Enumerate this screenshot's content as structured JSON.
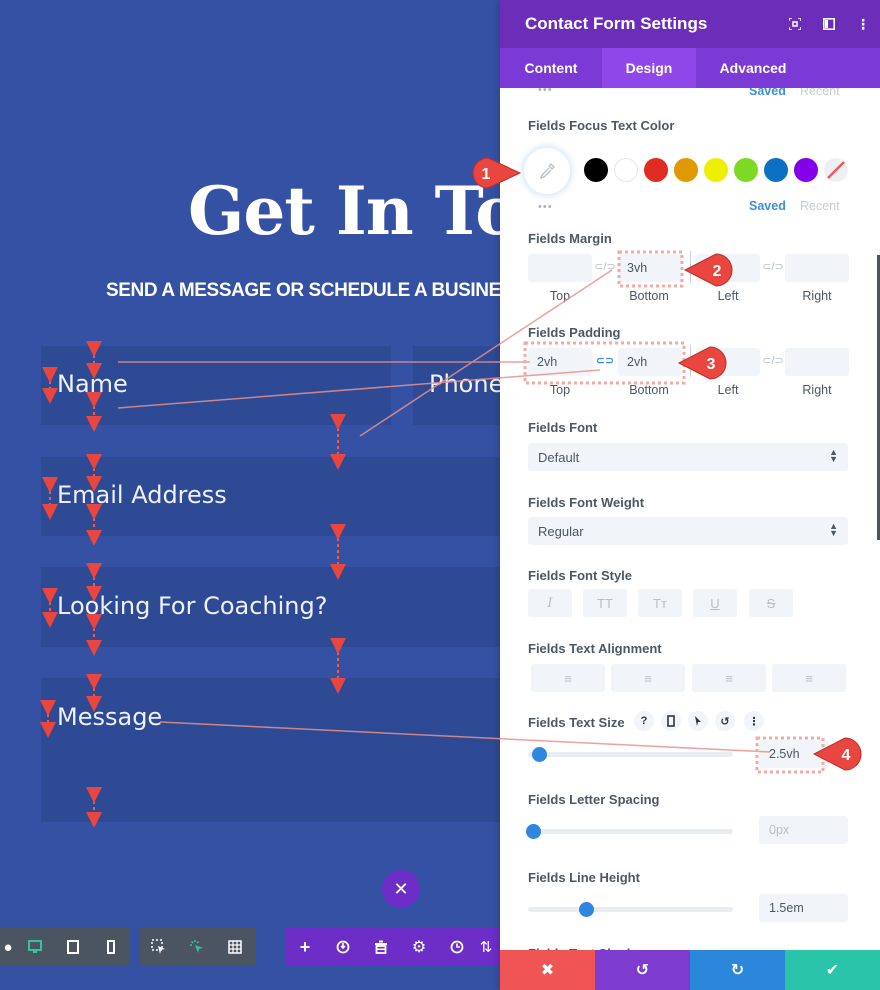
{
  "canvas": {
    "title": "Get In Touch",
    "subtitle": "SEND A MESSAGE OR SCHEDULE A BUSINESS",
    "fields": {
      "name": "Name",
      "phone": "Phone",
      "email": "Email Address",
      "coaching": "Looking For Coaching?",
      "message": "Message"
    },
    "close_icon": "close-icon",
    "toolbar": {
      "view_group": [
        "wireframe-icon",
        "desktop-icon",
        "tablet-icon",
        "phone-icon"
      ],
      "select_group": [
        "selection-icon",
        "hover-icon",
        "grid-icon"
      ],
      "action_group": [
        "add-icon",
        "power-icon",
        "trash-icon",
        "gear-icon",
        "history-icon",
        "portability-icon"
      ]
    }
  },
  "panel": {
    "title": "Contact Form Settings",
    "header_icons": [
      "fullscreen-icon",
      "sidebar-icon",
      "more-icon"
    ],
    "tabs": [
      {
        "label": "Content",
        "active": false
      },
      {
        "label": "Design",
        "active": true
      },
      {
        "label": "Advanced",
        "active": false
      }
    ],
    "top_saved": "Saved",
    "top_recent": "Recent",
    "focus_text_color": {
      "label": "Fields Focus Text Color",
      "swatches": [
        "#000000",
        "#ffffff",
        "#e02b20",
        "#e09900",
        "#edf000",
        "#7cda24",
        "#0c71c3",
        "#8300e9"
      ],
      "saved": "Saved",
      "recent": "Recent"
    },
    "margin": {
      "label": "Fields Margin",
      "top": "",
      "bottom": "3vh",
      "left": "",
      "right": "",
      "sides": [
        "Top",
        "Bottom",
        "Left",
        "Right"
      ]
    },
    "padding": {
      "label": "Fields Padding",
      "top": "2vh",
      "bottom": "2vh",
      "left": "",
      "right": "",
      "sides": [
        "Top",
        "Bottom",
        "Left",
        "Right"
      ]
    },
    "font": {
      "label": "Fields Font",
      "value": "Default"
    },
    "font_weight": {
      "label": "Fields Font Weight",
      "value": "Regular"
    },
    "font_style": {
      "label": "Fields Font Style",
      "buttons": [
        "I",
        "TT",
        "Tт",
        "U",
        "S"
      ]
    },
    "text_alignment": {
      "label": "Fields Text Alignment",
      "buttons": [
        "align-left",
        "align-center",
        "align-right",
        "align-justify"
      ]
    },
    "text_size": {
      "label": "Fields Text Size",
      "value": "2.5vh",
      "slider_fraction": 0.03,
      "help": "?",
      "icons": [
        "help-icon",
        "responsive-icon",
        "hover-icon",
        "reset-icon",
        "more-icon"
      ]
    },
    "letter_spacing": {
      "label": "Fields Letter Spacing",
      "value": "0px",
      "slider_fraction": 0.0
    },
    "line_height": {
      "label": "Fields Line Height",
      "value": "1.5em",
      "slider_fraction": 0.26
    },
    "next_label": "Fields Text Shadow",
    "footer": [
      "cancel-icon",
      "undo-icon",
      "redo-icon",
      "save-icon"
    ]
  },
  "annotations": {
    "markers": [
      "1",
      "2",
      "3",
      "4"
    ],
    "color": "#e8463e"
  }
}
